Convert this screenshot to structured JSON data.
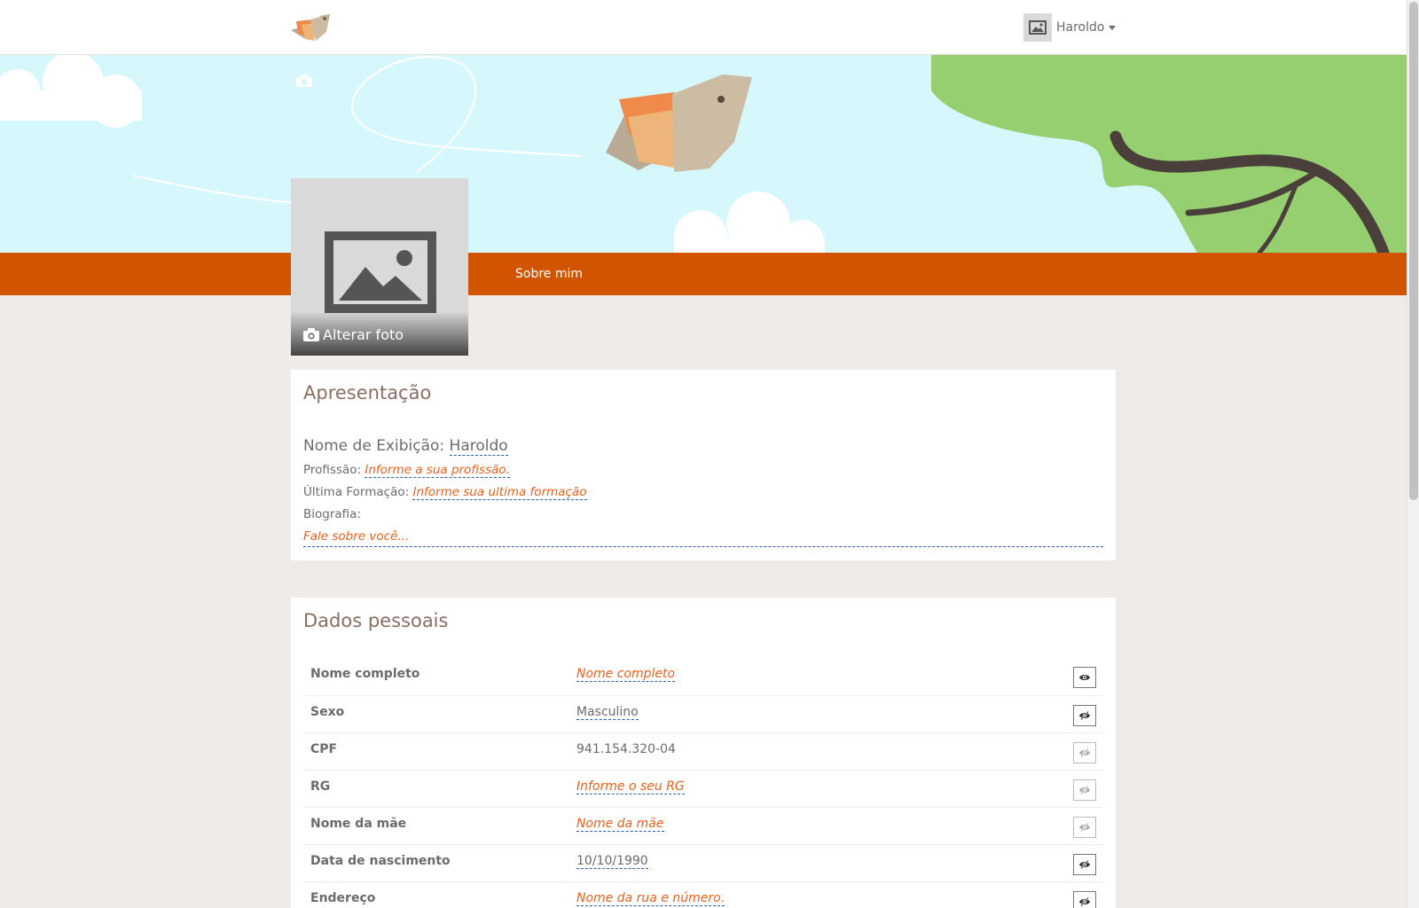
{
  "navbar": {
    "user_name": "Haroldo"
  },
  "tabs": {
    "about": "Sobre mim"
  },
  "profile_photo": {
    "change_label": "Alterar foto"
  },
  "presentation": {
    "title": "Apresentação",
    "display_name_label": "Nome de Exibição:",
    "display_name_value": "Haroldo",
    "profession_label": "Profissão:",
    "profession_placeholder": "Informe a sua profissão.",
    "education_label": "Última Formação:",
    "education_placeholder": "Informe sua ultima formação",
    "bio_label": "Biografia:",
    "bio_placeholder": "Fale sobre você..."
  },
  "personal": {
    "title": "Dados pessoais",
    "rows": [
      {
        "label": "Nome completo",
        "value": "Nome completo",
        "visibility": "public"
      },
      {
        "label": "Sexo",
        "value": "Masculino",
        "visibility": "hidden"
      },
      {
        "label": "CPF",
        "value": "941.154.320-04",
        "visibility": "hidden"
      },
      {
        "label": "RG",
        "value": "Informe o seu RG",
        "visibility": "hidden"
      },
      {
        "label": "Nome da mãe",
        "value": "Nome da mãe",
        "visibility": "hidden"
      },
      {
        "label": "Data de nascimento",
        "value": "10/10/1990",
        "visibility": "hidden"
      },
      {
        "label": "Endereço",
        "value": "Nome da rua e número.",
        "visibility": "hidden"
      }
    ]
  },
  "colors": {
    "accent": "#d25400",
    "placeholder": "#e8601c",
    "title": "#8b6e63",
    "banner_sky": "#d6f8fc",
    "banner_tree": "#96cf6f"
  }
}
